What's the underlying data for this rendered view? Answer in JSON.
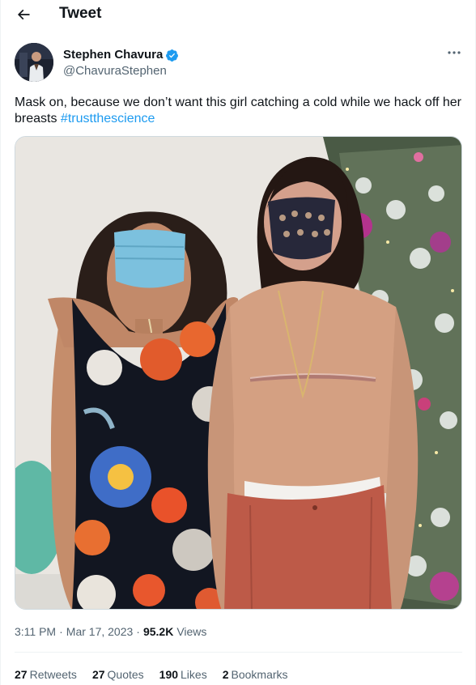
{
  "header": {
    "title": "Tweet",
    "back_icon": "arrow-left-icon"
  },
  "author": {
    "display_name": "Stephen Chavura",
    "handle": "@ChavuraStephen",
    "verified_color": "#1d9bf0",
    "more_icon": "more-horizontal-icon"
  },
  "tweet": {
    "text": "Mask on, because we don’t want this girl catching a cold while we hack off her breasts ",
    "hashtag": "#trustthescience"
  },
  "meta": {
    "time": "3:11 PM",
    "separator1": "·",
    "date": "Mar 17, 2023",
    "separator2": "·",
    "views_count": "95.2K",
    "views_label": "Views"
  },
  "stats": {
    "retweets_count": "27",
    "retweets_label": "Retweets",
    "quotes_count": "27",
    "quotes_label": "Quotes",
    "likes_count": "190",
    "likes_label": "Likes",
    "bookmarks_count": "2",
    "bookmarks_label": "Bookmarks"
  },
  "colors": {
    "link": "#1d9bf0",
    "secondary_text": "#536471",
    "primary_text": "#0f1419"
  }
}
